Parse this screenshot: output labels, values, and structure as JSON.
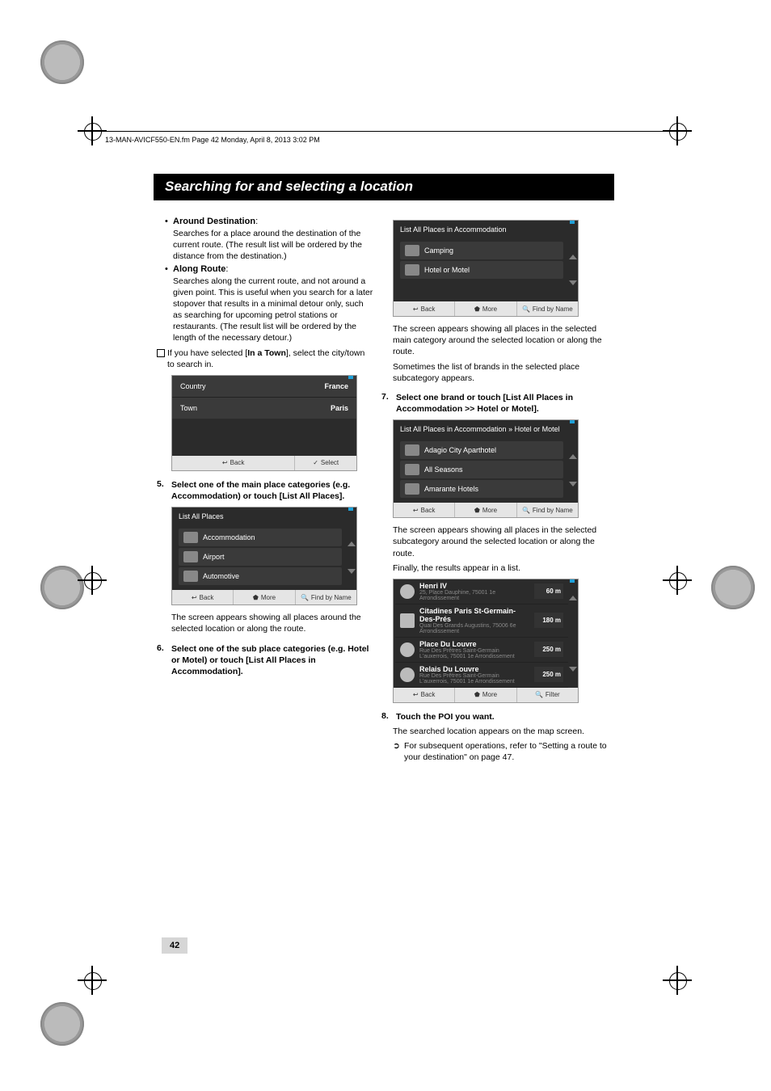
{
  "header_line": "13-MAN-AVICF550-EN.fm  Page 42  Monday, April 8, 2013  3:02 PM",
  "section_title": "Searching for and selecting a location",
  "col1": {
    "b1_title": "Around Destination",
    "b1_text": "Searches for a place around the destination of the current route. (The result list will be ordered by the distance from the destination.)",
    "b2_title": "Along Route",
    "b2_text": "Searches along the current route, and not around a given point. This is useful when you search for a later stopover that results in a minimal detour only, such as searching for upcoming petrol stations or restaurants. (The result list will be ordered by the length of the necessary detour.)",
    "note1_pre": "If you have selected [",
    "note1_bold": "In a Town",
    "note1_post": "], select the city/town to search in.",
    "step5": "Select one of the main place categories (e.g. Accommodation) or touch [List All Places].",
    "step5_after": "The screen appears showing all places around the selected location or along the route.",
    "step6": "Select one of the sub place categories (e.g. Hotel or Motel) or touch [List All Places in Accommodation].",
    "sim_kv": {
      "row1_label": "Country",
      "row1_value": "France",
      "row2_label": "Town",
      "row2_value": "Paris",
      "back": "Back",
      "select": "Select"
    },
    "sim_cat": {
      "header": "List All Places",
      "items": [
        "Accommodation",
        "Airport",
        "Automotive"
      ],
      "back": "Back",
      "more": "More",
      "find": "Find by Name"
    }
  },
  "col2": {
    "sim_sub": {
      "header": "List All Places in Accommodation",
      "items": [
        "Camping",
        "Hotel or Motel"
      ],
      "back": "Back",
      "more": "More",
      "find": "Find by Name"
    },
    "p1": "The screen appears showing all places in the selected main category around the selected location or along the route.",
    "p2": "Sometimes the list of brands in the selected place subcategory appears.",
    "step7": "Select one brand or touch [List All Places in Accommodation >> Hotel or Motel].",
    "sim_brand": {
      "header": "List All Places in Accommodation » Hotel or Motel",
      "items": [
        "Adagio City Aparthotel",
        "All Seasons",
        "Amarante Hotels"
      ],
      "back": "Back",
      "more": "More",
      "find": "Find by Name"
    },
    "p3": "The screen appears showing all places in the selected subcategory around the selected location or along the route.",
    "p4": "Finally, the results appear in a list.",
    "sim_results": {
      "rows": [
        {
          "name": "Henri IV",
          "sub": "25, Place Dauphine, 75001 1e Arrondissement",
          "dist": "60 m"
        },
        {
          "name": "Citadines Paris St-Germain-Des-Prés",
          "sub": "Quai Des Grands Augustins, 75006 6e Arrondissement",
          "dist": "180 m"
        },
        {
          "name": "Place Du Louvre",
          "sub": "Rue Des Prêtres Saint-Germain L'auxerrois, 75001 1e Arrondissement",
          "dist": "250 m"
        },
        {
          "name": "Relais Du Louvre",
          "sub": "Rue Des Prêtres Saint-Germain L'auxerrois, 75001 1e Arrondissement",
          "dist": "250 m"
        }
      ],
      "back": "Back",
      "more": "More",
      "filter": "Filter"
    },
    "step8": "Touch the POI you want.",
    "step8_after": "The searched location appears on the map screen.",
    "ref": "For subsequent operations, refer to \"Setting a route to your destination\" on page 47."
  },
  "page_number": "42"
}
